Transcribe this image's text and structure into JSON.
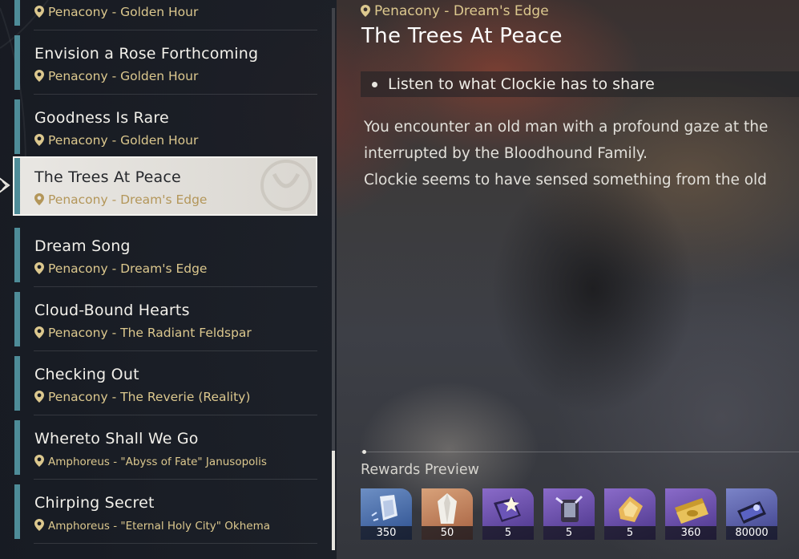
{
  "quest_list": {
    "items": [
      {
        "title": "",
        "location": "Penacony - Golden Hour",
        "small": false
      },
      {
        "title": "Envision a Rose Forthcoming",
        "location": "Penacony - Golden Hour",
        "small": false
      },
      {
        "title": "Goodness Is Rare",
        "location": "Penacony - Golden Hour",
        "small": false
      },
      {
        "title": "The Trees At Peace",
        "location": "Penacony - Dream's Edge",
        "small": false,
        "selected": true
      },
      {
        "title": "Dream Song",
        "location": "Penacony - Dream's Edge",
        "small": false
      },
      {
        "title": "Cloud-Bound Hearts",
        "location": "Penacony - The Radiant Feldspar",
        "small": false
      },
      {
        "title": "Checking Out",
        "location": "Penacony - The Reverie (Reality)",
        "small": false
      },
      {
        "title": "Whereto Shall We Go",
        "location": "Amphoreus - \"Abyss of Fate\" Janusopolis",
        "small": true
      },
      {
        "title": "Chirping Secret",
        "location": "Amphoreus - \"Eternal Holy City\" Okhema",
        "small": true
      }
    ]
  },
  "detail": {
    "location": "Penacony - Dream's Edge",
    "title": "The Trees At Peace",
    "objective": "Listen to what Clockie has to share",
    "description_lines": [
      "You encounter an old man with a profound gaze at the",
      "interrupted by the Bloodhound Family.",
      "Clockie seems to have sensed something from the old"
    ]
  },
  "rewards": {
    "label": "Rewards Preview",
    "items": [
      {
        "icon": "stellar-jade-icon",
        "count": "350",
        "style": "blue"
      },
      {
        "icon": "crystal-icon",
        "count": "50",
        "style": "gold"
      },
      {
        "icon": "purple-book-icon",
        "count": "5",
        "style": "purple"
      },
      {
        "icon": "refine-material-icon",
        "count": "5",
        "style": "purple"
      },
      {
        "icon": "gold-material-icon",
        "count": "5",
        "style": "purple"
      },
      {
        "icon": "credits-icon",
        "count": "360",
        "style": "purple"
      },
      {
        "icon": "exp-material-icon",
        "count": "80000",
        "style": "blue"
      }
    ]
  }
}
